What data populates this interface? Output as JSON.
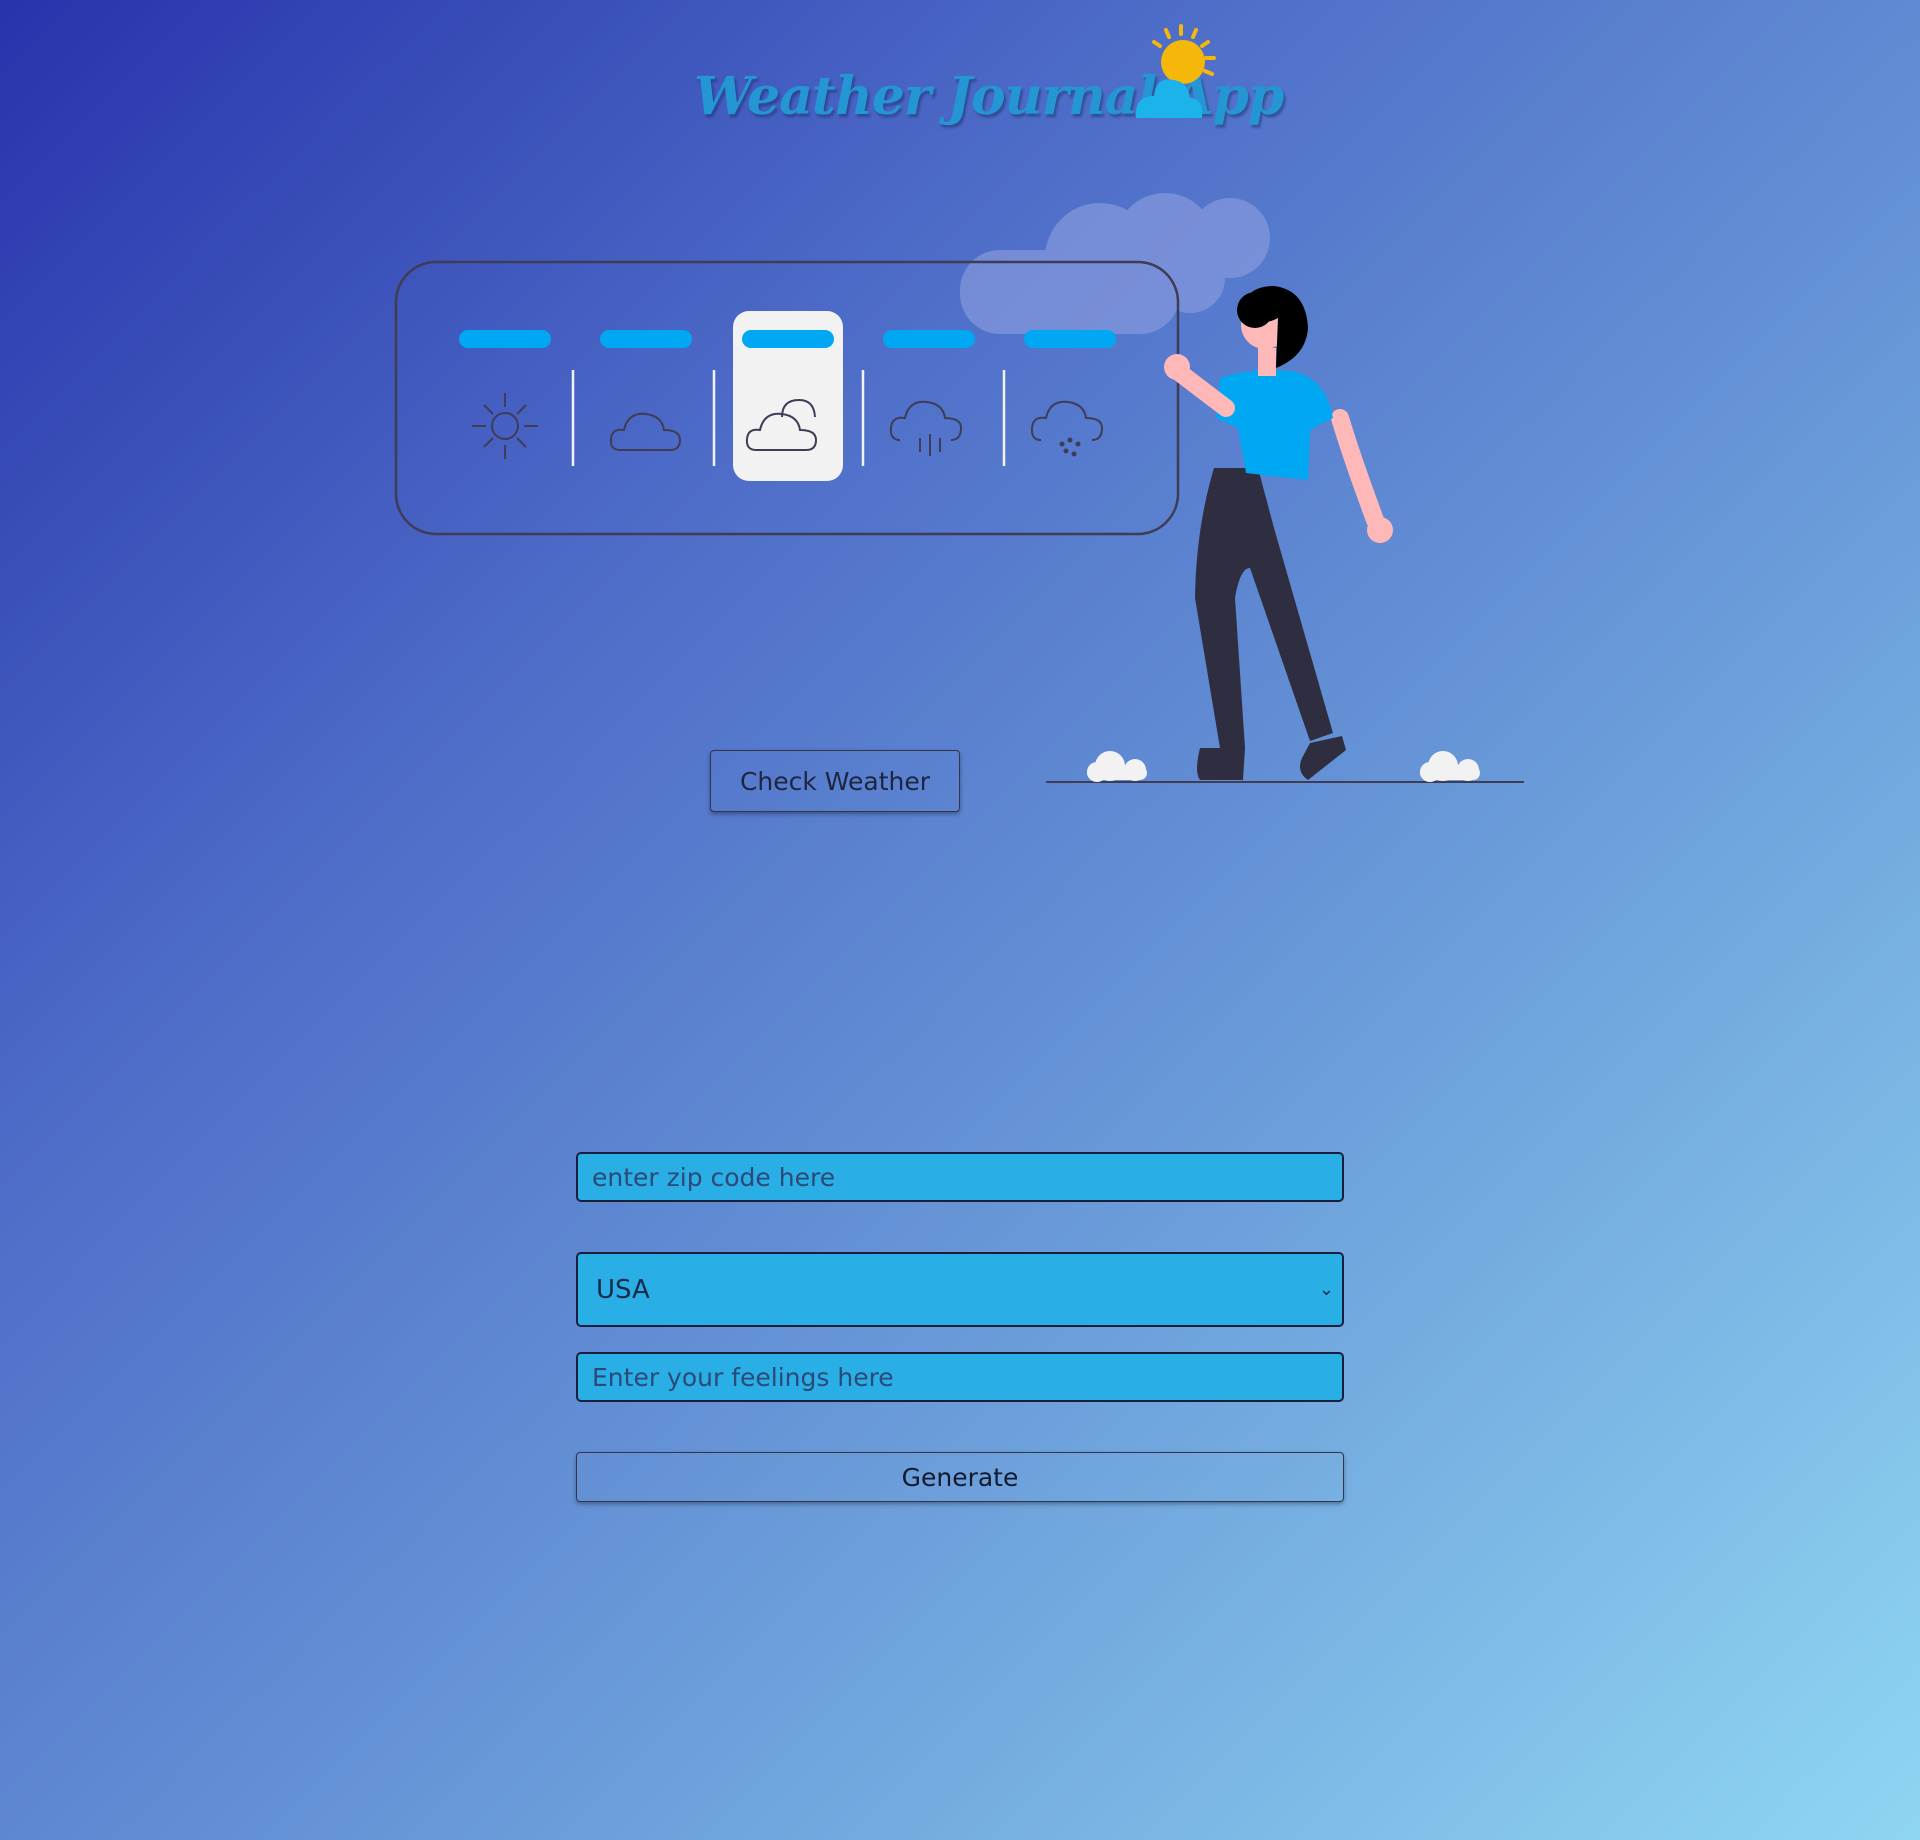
{
  "header": {
    "title": "Weather Journal App",
    "logo_icon": "sun-behind-cloud-icon"
  },
  "hero": {
    "illustration": "woman-selecting-weather-illustration",
    "weather_icons": [
      "sun-icon",
      "cloud-icon",
      "partly-cloudy-icon",
      "rain-cloud-icon",
      "hail-cloud-icon"
    ],
    "selected_index": 2
  },
  "actions": {
    "check_weather_label": "Check Weather",
    "generate_label": "Generate"
  },
  "form": {
    "zip_placeholder": "enter zip code here",
    "country_selected": "USA",
    "feelings_placeholder": "Enter your feelings here"
  },
  "colors": {
    "accent": "#00a8f3",
    "field_bg": "#2aaee6",
    "title": "#2596d4",
    "outline": "#3f3d56"
  }
}
